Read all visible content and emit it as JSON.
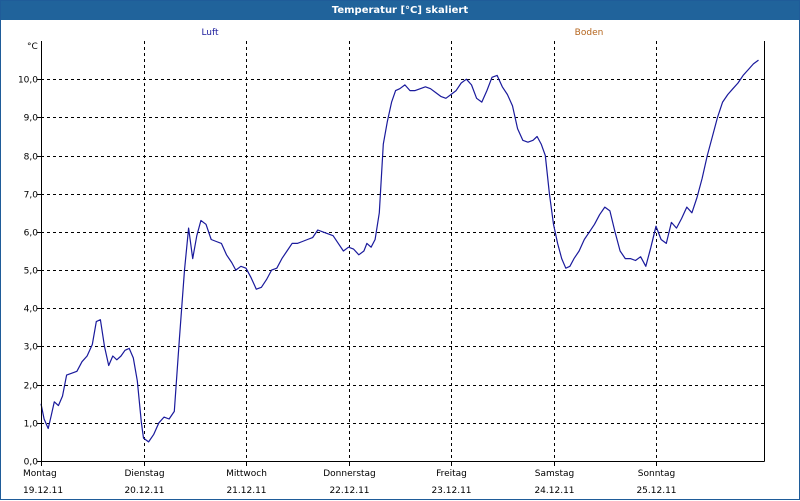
{
  "window": {
    "title": "Temperatur [°C] skaliert"
  },
  "chart_data": {
    "type": "line",
    "title": "Temperatur [°C] skaliert",
    "ylabel": "°C",
    "ylim": [
      0,
      11
    ],
    "xlim": [
      0,
      7
    ],
    "grid": true,
    "legend": [
      {
        "name": "Luft",
        "color": "#1a1a9c"
      },
      {
        "name": "Boden",
        "color": "#b5651d"
      }
    ],
    "yticks": [
      {
        "v": 0,
        "label": "0,0"
      },
      {
        "v": 1,
        "label": "1,0"
      },
      {
        "v": 2,
        "label": "2,0"
      },
      {
        "v": 3,
        "label": "3,0"
      },
      {
        "v": 4,
        "label": "4,0"
      },
      {
        "v": 5,
        "label": "5,0"
      },
      {
        "v": 6,
        "label": "6,0"
      },
      {
        "v": 7,
        "label": "7,0"
      },
      {
        "v": 8,
        "label": "8,0"
      },
      {
        "v": 9,
        "label": "9,0"
      },
      {
        "v": 10,
        "label": "10,0"
      }
    ],
    "xticks": [
      {
        "day": "Montag",
        "date": "19.12.11"
      },
      {
        "day": "Dienstag",
        "date": "20.12.11"
      },
      {
        "day": "Mittwoch",
        "date": "21.12.11"
      },
      {
        "day": "Donnerstag",
        "date": "22.12.11"
      },
      {
        "day": "Freitag",
        "date": "23.12.11"
      },
      {
        "day": "Samstag",
        "date": "24.12.11"
      },
      {
        "day": "Sonntag",
        "date": "25.12.11"
      }
    ],
    "series": [
      {
        "name": "Luft",
        "color": "#1a1a9c",
        "points": [
          [
            0.0,
            1.5
          ],
          [
            0.03,
            1.1
          ],
          [
            0.07,
            0.85
          ],
          [
            0.1,
            1.2
          ],
          [
            0.13,
            1.55
          ],
          [
            0.17,
            1.45
          ],
          [
            0.21,
            1.7
          ],
          [
            0.25,
            2.25
          ],
          [
            0.3,
            2.3
          ],
          [
            0.35,
            2.35
          ],
          [
            0.4,
            2.6
          ],
          [
            0.45,
            2.75
          ],
          [
            0.5,
            3.05
          ],
          [
            0.54,
            3.65
          ],
          [
            0.58,
            3.7
          ],
          [
            0.62,
            3.0
          ],
          [
            0.66,
            2.5
          ],
          [
            0.7,
            2.75
          ],
          [
            0.74,
            2.65
          ],
          [
            0.78,
            2.75
          ],
          [
            0.82,
            2.9
          ],
          [
            0.86,
            2.95
          ],
          [
            0.9,
            2.7
          ],
          [
            0.94,
            2.1
          ],
          [
            0.98,
            1.0
          ],
          [
            1.0,
            0.6
          ],
          [
            1.05,
            0.5
          ],
          [
            1.1,
            0.7
          ],
          [
            1.15,
            1.0
          ],
          [
            1.2,
            1.15
          ],
          [
            1.25,
            1.1
          ],
          [
            1.3,
            1.3
          ],
          [
            1.35,
            3.2
          ],
          [
            1.4,
            5.0
          ],
          [
            1.44,
            6.1
          ],
          [
            1.48,
            5.3
          ],
          [
            1.52,
            5.9
          ],
          [
            1.56,
            6.3
          ],
          [
            1.61,
            6.2
          ],
          [
            1.66,
            5.8
          ],
          [
            1.71,
            5.75
          ],
          [
            1.76,
            5.7
          ],
          [
            1.81,
            5.4
          ],
          [
            1.86,
            5.2
          ],
          [
            1.9,
            5.0
          ],
          [
            1.95,
            5.1
          ],
          [
            2.0,
            5.05
          ],
          [
            2.05,
            4.8
          ],
          [
            2.1,
            4.5
          ],
          [
            2.15,
            4.55
          ],
          [
            2.2,
            4.75
          ],
          [
            2.25,
            5.0
          ],
          [
            2.3,
            5.05
          ],
          [
            2.35,
            5.3
          ],
          [
            2.4,
            5.5
          ],
          [
            2.45,
            5.7
          ],
          [
            2.5,
            5.7
          ],
          [
            2.55,
            5.75
          ],
          [
            2.6,
            5.8
          ],
          [
            2.65,
            5.85
          ],
          [
            2.7,
            6.05
          ],
          [
            2.75,
            6.0
          ],
          [
            2.8,
            5.95
          ],
          [
            2.85,
            5.9
          ],
          [
            2.9,
            5.7
          ],
          [
            2.95,
            5.5
          ],
          [
            3.0,
            5.6
          ],
          [
            3.05,
            5.55
          ],
          [
            3.1,
            5.4
          ],
          [
            3.15,
            5.5
          ],
          [
            3.18,
            5.7
          ],
          [
            3.22,
            5.6
          ],
          [
            3.26,
            5.8
          ],
          [
            3.3,
            6.5
          ],
          [
            3.34,
            8.3
          ],
          [
            3.38,
            8.9
          ],
          [
            3.42,
            9.4
          ],
          [
            3.46,
            9.7
          ],
          [
            3.5,
            9.75
          ],
          [
            3.55,
            9.85
          ],
          [
            3.6,
            9.7
          ],
          [
            3.65,
            9.7
          ],
          [
            3.7,
            9.75
          ],
          [
            3.75,
            9.8
          ],
          [
            3.8,
            9.75
          ],
          [
            3.85,
            9.65
          ],
          [
            3.9,
            9.55
          ],
          [
            3.95,
            9.5
          ],
          [
            4.0,
            9.6
          ],
          [
            4.05,
            9.7
          ],
          [
            4.1,
            9.9
          ],
          [
            4.15,
            10.0
          ],
          [
            4.2,
            9.85
          ],
          [
            4.25,
            9.5
          ],
          [
            4.3,
            9.4
          ],
          [
            4.35,
            9.7
          ],
          [
            4.4,
            10.05
          ],
          [
            4.45,
            10.1
          ],
          [
            4.5,
            9.8
          ],
          [
            4.55,
            9.6
          ],
          [
            4.6,
            9.3
          ],
          [
            4.65,
            8.7
          ],
          [
            4.7,
            8.4
          ],
          [
            4.75,
            8.35
          ],
          [
            4.8,
            8.4
          ],
          [
            4.84,
            8.5
          ],
          [
            4.88,
            8.3
          ],
          [
            4.92,
            8.0
          ],
          [
            4.96,
            7.0
          ],
          [
            5.0,
            6.2
          ],
          [
            5.04,
            5.7
          ],
          [
            5.08,
            5.3
          ],
          [
            5.12,
            5.05
          ],
          [
            5.16,
            5.1
          ],
          [
            5.2,
            5.3
          ],
          [
            5.25,
            5.5
          ],
          [
            5.3,
            5.8
          ],
          [
            5.35,
            6.0
          ],
          [
            5.4,
            6.2
          ],
          [
            5.45,
            6.45
          ],
          [
            5.5,
            6.65
          ],
          [
            5.55,
            6.55
          ],
          [
            5.6,
            6.0
          ],
          [
            5.65,
            5.5
          ],
          [
            5.7,
            5.3
          ],
          [
            5.75,
            5.3
          ],
          [
            5.8,
            5.25
          ],
          [
            5.85,
            5.35
          ],
          [
            5.9,
            5.1
          ],
          [
            5.95,
            5.6
          ],
          [
            6.0,
            6.15
          ],
          [
            6.05,
            5.8
          ],
          [
            6.1,
            5.7
          ],
          [
            6.15,
            6.25
          ],
          [
            6.2,
            6.1
          ],
          [
            6.25,
            6.35
          ],
          [
            6.3,
            6.65
          ],
          [
            6.35,
            6.5
          ],
          [
            6.4,
            6.9
          ],
          [
            6.45,
            7.4
          ],
          [
            6.5,
            8.0
          ],
          [
            6.55,
            8.5
          ],
          [
            6.6,
            9.0
          ],
          [
            6.65,
            9.4
          ],
          [
            6.7,
            9.6
          ],
          [
            6.75,
            9.75
          ],
          [
            6.8,
            9.9
          ],
          [
            6.85,
            10.1
          ],
          [
            6.9,
            10.25
          ],
          [
            6.95,
            10.4
          ],
          [
            7.0,
            10.5
          ]
        ]
      }
    ]
  }
}
